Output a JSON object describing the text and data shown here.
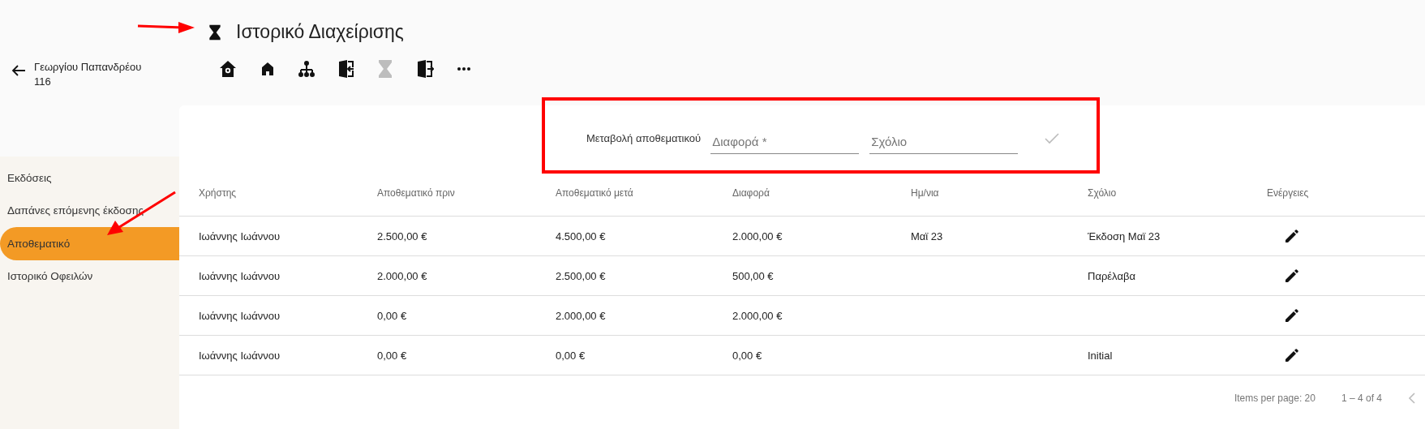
{
  "page_title": "Ιστορικό Διαχείρισης",
  "back": {
    "label": "Γεωργίου Παπανδρέου 116"
  },
  "toolbar": [
    {
      "kind": "home-badge",
      "selected": false
    },
    {
      "kind": "home",
      "selected": false
    },
    {
      "kind": "hierarchy",
      "selected": false
    },
    {
      "kind": "door-in",
      "selected": false
    },
    {
      "kind": "hourglass",
      "selected": true
    },
    {
      "kind": "door-out",
      "selected": false
    },
    {
      "kind": "more",
      "selected": false
    }
  ],
  "sidebar": {
    "items": [
      {
        "label": "Εκδόσεις",
        "selected": false
      },
      {
        "label": "Δαπάνες επόμενης έκδοσης",
        "selected": false
      },
      {
        "label": "Αποθεματικό",
        "selected": true
      },
      {
        "label": "Ιστορικό Οφειλών",
        "selected": false
      }
    ]
  },
  "form": {
    "label": "Μεταβολή αποθεματικού",
    "fields": [
      {
        "placeholder": "Διαφορά *"
      },
      {
        "placeholder": "Σχόλιο"
      }
    ],
    "submit_disabled": true
  },
  "table": {
    "columns": [
      "Χρήστης",
      "Αποθεματικό πριν",
      "Αποθεματικό μετά",
      "Διαφορά",
      "Ημ/νια",
      "Σχόλιο",
      "Ενέργειες"
    ],
    "rows": [
      {
        "cells": [
          "Ιωάννης Ιωάννου",
          "2.500,00 €",
          "4.500,00 €",
          "2.000,00 €",
          "Μαϊ 23",
          "Έκδοση Μαϊ 23"
        ]
      },
      {
        "cells": [
          "Ιωάννης Ιωάννου",
          "2.000,00 €",
          "2.500,00 €",
          "500,00 €",
          null,
          "Παρέλαβα"
        ]
      },
      {
        "cells": [
          "Ιωάννης Ιωάννου",
          "0,00 €",
          "2.000,00 €",
          "2.000,00 €",
          null,
          null
        ]
      },
      {
        "cells": [
          "Ιωάννης Ιωάννου",
          "0,00 €",
          "0,00 €",
          "0,00 €",
          null,
          "Initial"
        ]
      }
    ]
  },
  "paginator": {
    "items_per_page_label": "Items per page:",
    "items_per_page": "20",
    "range": "1 – 4 of 4"
  },
  "annotations": [
    {
      "kind": "arrow"
    },
    {
      "kind": "arrow"
    },
    {
      "kind": "frame"
    }
  ]
}
